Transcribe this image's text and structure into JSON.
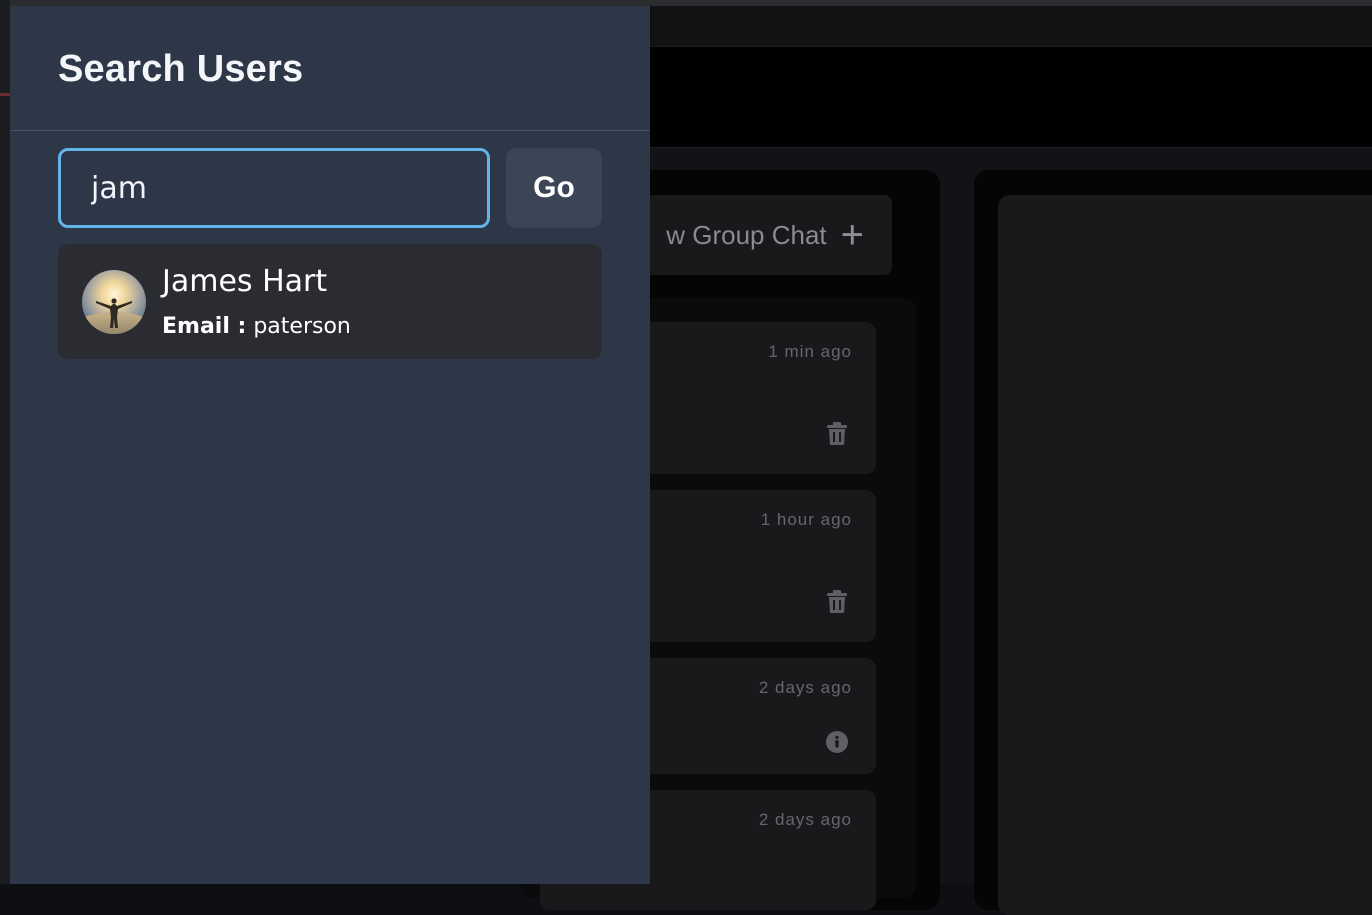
{
  "search_drawer": {
    "title": "Search Users",
    "search": {
      "value": "jam",
      "placeholder": ""
    },
    "go_label": "Go",
    "results": [
      {
        "name": "James Hart",
        "email_label": "Email :",
        "email": "paterson"
      }
    ]
  },
  "background": {
    "new_group_chat_label": "w Group Chat",
    "chats": [
      {
        "time": "1 min ago",
        "action_icon": "trash-icon"
      },
      {
        "time": "1 hour ago",
        "action_icon": "trash-icon"
      },
      {
        "time": "2 days ago",
        "action_icon": "info-icon"
      },
      {
        "time": "2 days ago"
      }
    ]
  },
  "colors": {
    "drawer_bg": "#2d3748",
    "focus_border": "#63b3ed",
    "go_button_bg": "#3b4556",
    "result_card_bg": "#2b2c31"
  }
}
